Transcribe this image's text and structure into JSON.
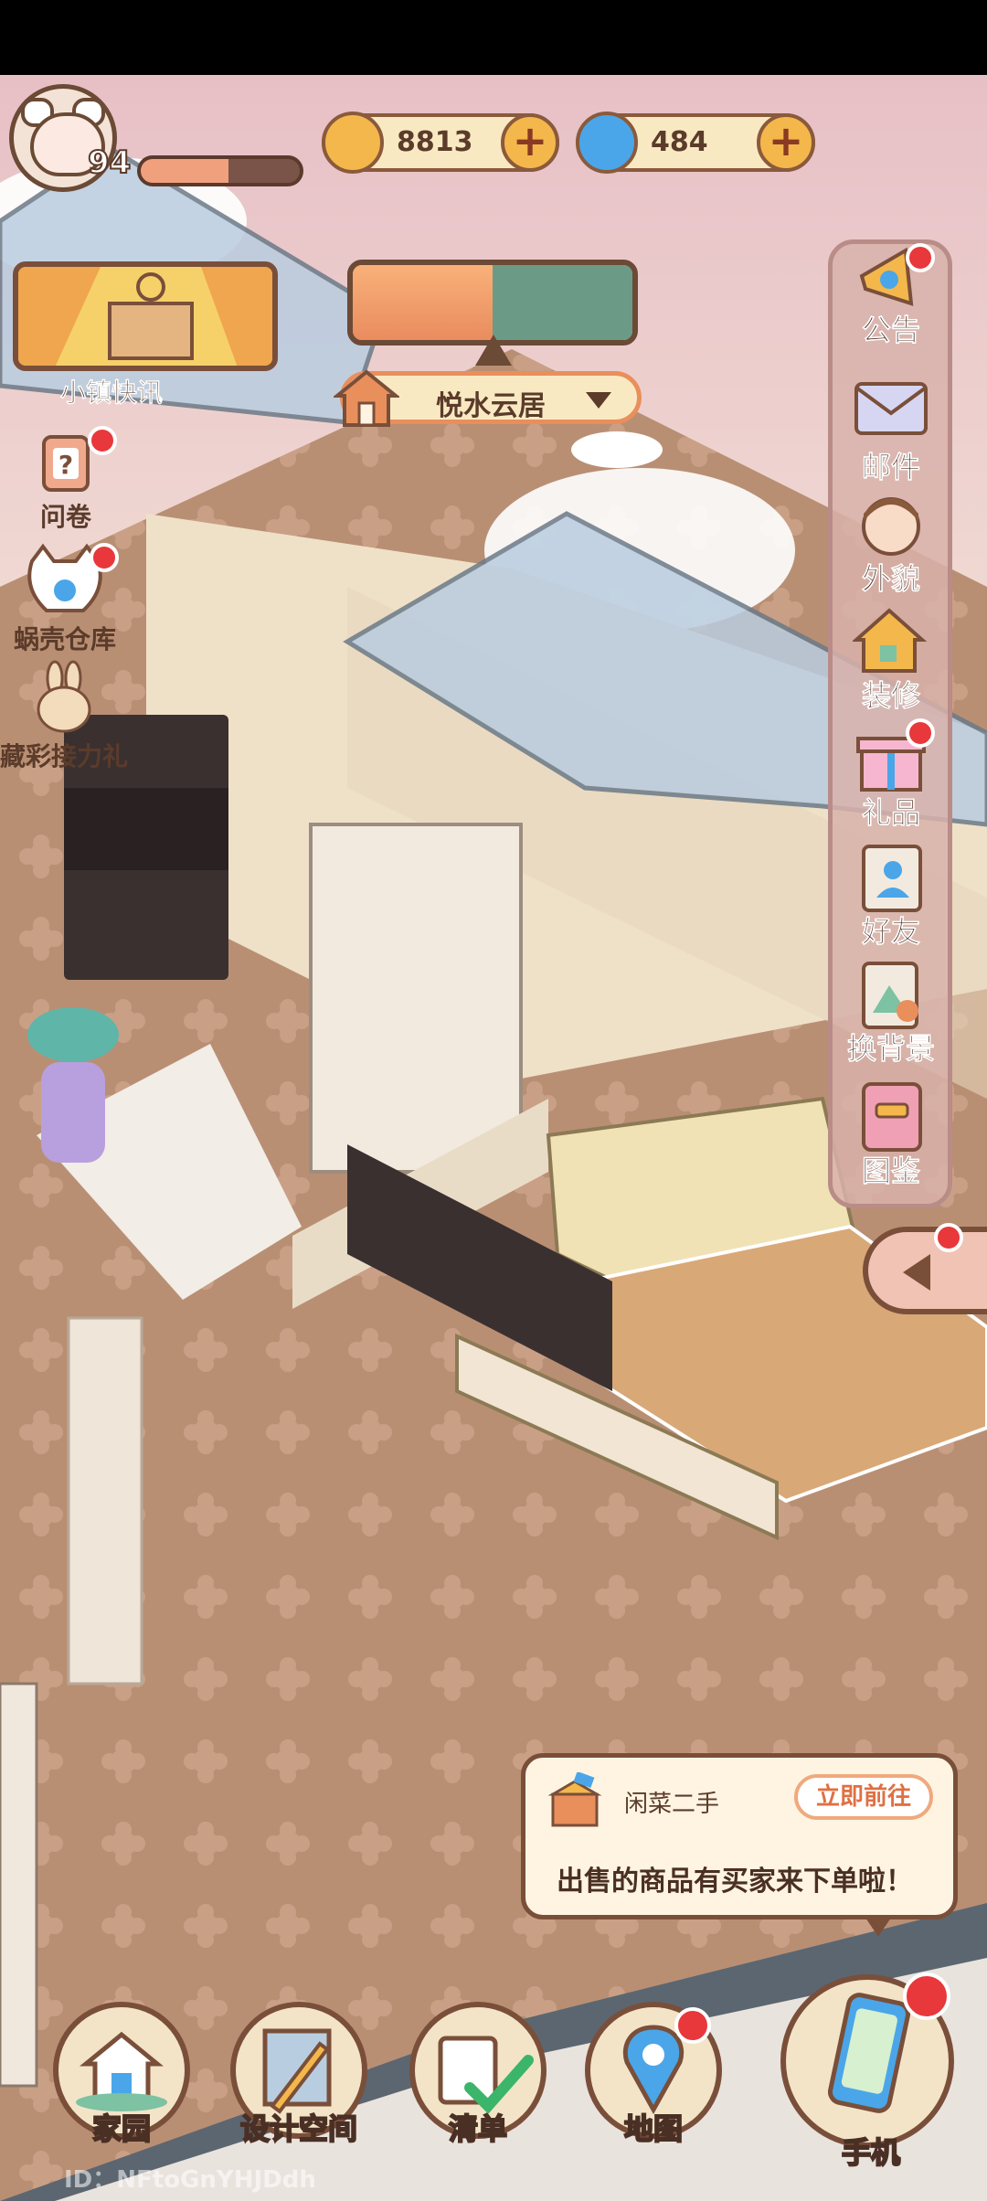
{
  "player": {
    "level": "94",
    "hp_fraction": 0.55
  },
  "currencies": [
    {
      "name": "coin",
      "value": "8813",
      "color": "#f4b74b"
    },
    {
      "name": "shell",
      "value": "484",
      "color": "#4aa6e8"
    }
  ],
  "news": {
    "label": "小镇快讯"
  },
  "location": {
    "name": "悦水云居"
  },
  "left_menu": [
    {
      "label": "问卷",
      "badge": true
    },
    {
      "label": "蜗壳仓库",
      "badge": true
    },
    {
      "label": "藏彩接力礼",
      "badge": false
    }
  ],
  "side_menu": [
    {
      "label": "公告",
      "icon": "megaphone-icon",
      "badge": true
    },
    {
      "label": "邮件",
      "icon": "mail-icon",
      "badge": false
    },
    {
      "label": "外貌",
      "icon": "avatar-icon",
      "badge": false
    },
    {
      "label": "装修",
      "icon": "house-wrench-icon",
      "badge": false
    },
    {
      "label": "礼品",
      "icon": "gift-icon",
      "badge": true
    },
    {
      "label": "好友",
      "icon": "friends-icon",
      "badge": false
    },
    {
      "label": "换背景",
      "icon": "background-icon",
      "badge": false
    },
    {
      "label": "图鉴",
      "icon": "catalog-icon",
      "badge": false
    }
  ],
  "notice": {
    "source": "闲菜二手",
    "action": "立即前往",
    "message": "出售的商品有买家来下单啦！"
  },
  "bottom_nav": [
    {
      "label": "家园",
      "icon": "home-icon",
      "badge": false
    },
    {
      "label": "设计空间",
      "icon": "design-icon",
      "badge": false
    },
    {
      "label": "清单",
      "icon": "checklist-icon",
      "badge": false
    },
    {
      "label": "地图",
      "icon": "map-pin-icon",
      "badge": true
    },
    {
      "label": "手机",
      "icon": "phone-icon",
      "badge": true
    }
  ],
  "user_id": "ID：NFtoGnYHJDdh",
  "colors": {
    "floor": "#b98f74",
    "wall": "#efe1c8",
    "sky": "#e9c4c8"
  }
}
